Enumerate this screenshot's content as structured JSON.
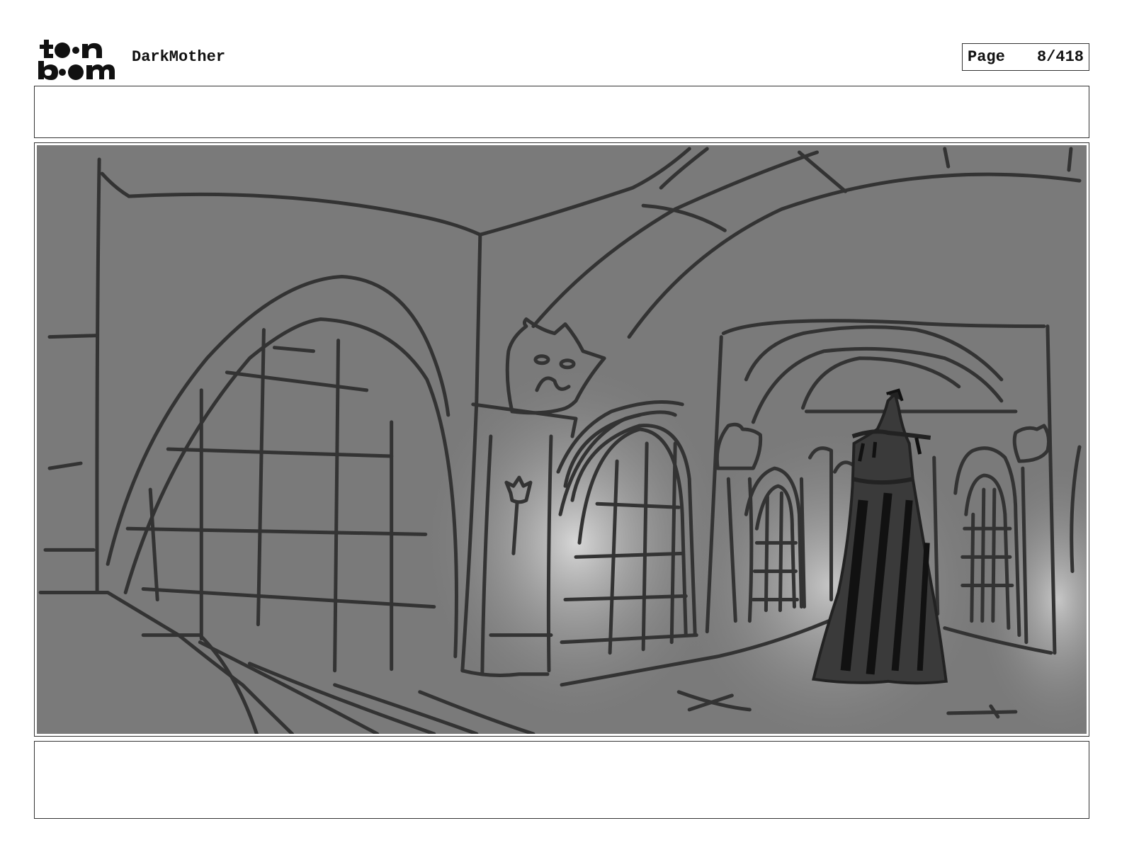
{
  "header": {
    "brand_logo": "toon boom",
    "project_title": "DarkMother",
    "page_label": "Page",
    "page_number": "8/418"
  },
  "panels": {
    "action_notes": "",
    "dialogue_notes": ""
  },
  "colors": {
    "sketch_background": "#7a7a7a",
    "sketch_line": "#333333",
    "glow": "#d8d8d8",
    "figure": "#1f1f1f"
  }
}
